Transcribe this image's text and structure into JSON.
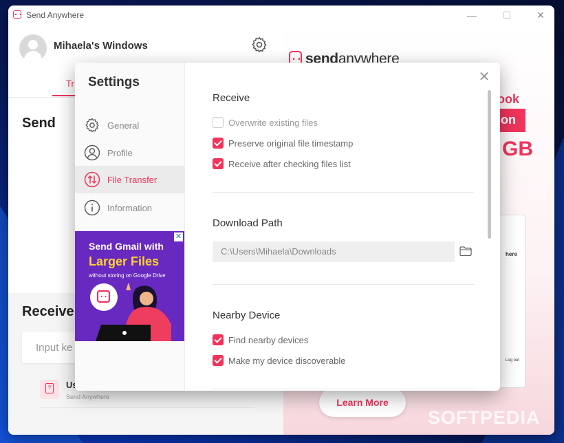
{
  "window": {
    "title": "Send Anywhere",
    "minimize": "—",
    "maximize": "☐",
    "close": "✕"
  },
  "main": {
    "device_name": "Mihaela's Windows",
    "tab_transfer": "Tr",
    "send_heading": "Send",
    "receive_heading": "Receive",
    "key_placeholder": "Input ke",
    "history_name": "Us",
    "history_sub": "Send Anywhere"
  },
  "ad_right": {
    "brand_left": "send",
    "brand_right": "anywhere",
    "line1": "look",
    "line2": "on",
    "line3": "GB",
    "mock_text1": "here",
    "mock_text2": "Log out",
    "learn_more": "Learn More"
  },
  "watermark": "SOFTPEDIA",
  "settings": {
    "title": "Settings",
    "close": "✕",
    "nav": [
      {
        "label": "General",
        "icon": "gear-icon"
      },
      {
        "label": "Profile",
        "icon": "user-icon"
      },
      {
        "label": "File Transfer",
        "icon": "transfer-icon"
      },
      {
        "label": "Information",
        "icon": "info-icon"
      }
    ],
    "active_nav": "File Transfer",
    "ad": {
      "line1": "Send Gmail with",
      "line2": "Larger Files",
      "line3": "without storing on Google Drive",
      "close": "✕"
    },
    "receive": {
      "heading": "Receive",
      "options": [
        {
          "label": "Overwrite existing files",
          "checked": false
        },
        {
          "label": "Preserve original file timestamp",
          "checked": true
        },
        {
          "label": "Receive after checking files list",
          "checked": true
        }
      ]
    },
    "download": {
      "heading": "Download Path",
      "path": "C:\\Users\\Mihaela\\Downloads"
    },
    "nearby": {
      "heading": "Nearby Device",
      "options": [
        {
          "label": "Find nearby devices",
          "checked": true
        },
        {
          "label": "Make my device discoverable",
          "checked": true
        }
      ]
    }
  },
  "colors": {
    "accent": "#f0345c",
    "ad_purple": "#6829c0",
    "ad_yellow": "#ffd22e"
  }
}
